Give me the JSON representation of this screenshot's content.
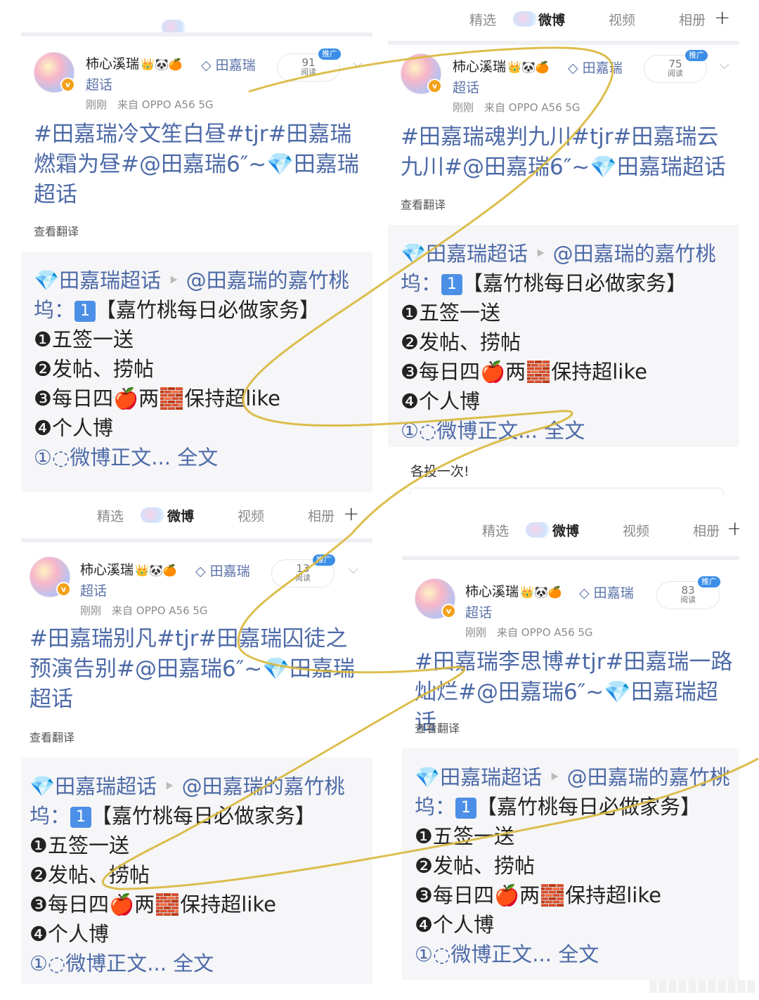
{
  "tabs": {
    "featured": "精选",
    "weibo": "微博",
    "video": "视频",
    "album": "相册"
  },
  "posts": [
    {
      "username": "柿心溪瑞",
      "badges": "👑🐼🍊",
      "topic": "田嘉瑞",
      "topic_suffix": "超话",
      "meta_time": "刚刚",
      "meta_source": "来自 OPPO A56 5G",
      "reads": "91",
      "reads_label": "阅读",
      "promo": "推广",
      "headline": "#田嘉瑞冷文笙白昼#tjr#田嘉瑞燃霜为昼#@田嘉瑞6″~💎田嘉瑞超话",
      "translate": "查看翻译",
      "quote_l1a": "💎田嘉瑞超话",
      "quote_l1b": "@田嘉瑞的嘉竹桃",
      "quote_l2a": "坞：",
      "quote_l2c": "【嘉竹桃每日必做家务】",
      "quote_l3": "❶五签一送",
      "quote_l4": "❷发帖、捞帖",
      "quote_l5": "❸每日四🍎两🧱保持超like",
      "quote_l6": "❹个人博",
      "quote_l7a": "①◌微博正文...",
      "quote_l7b": "全文",
      "comment_tip": "各投一次!"
    },
    {
      "username": "柿心溪瑞",
      "badges": "👑🐼🍊",
      "topic": "田嘉瑞",
      "topic_suffix": "超话",
      "meta_time": "刚刚",
      "meta_source": "来自 OPPO A56 5G",
      "reads": "75",
      "reads_label": "阅读",
      "promo": "推广",
      "headline": "#田嘉瑞魂判九川#tjr#田嘉瑞云九川#@田嘉瑞6″~💎田嘉瑞超话",
      "translate": "查看翻译",
      "quote_l1a": "💎田嘉瑞超话",
      "quote_l1b": "@田嘉瑞的嘉竹桃",
      "quote_l2a": "坞：",
      "quote_l2c": "【嘉竹桃每日必做家务】",
      "quote_l3": "❶五签一送",
      "quote_l4": "❷发帖、捞帖",
      "quote_l5": "❸每日四🍎两🧱保持超like",
      "quote_l6": "❹个人博",
      "quote_l7a": "①◌微博正文...",
      "quote_l7b": "全文",
      "comment_tip": "各投一次!"
    },
    {
      "username": "柿心溪瑞",
      "badges": "👑🐼🍊",
      "topic": "田嘉瑞",
      "topic_suffix": "超话",
      "meta_time": "刚刚",
      "meta_source": "来自 OPPO A56 5G",
      "reads": "13",
      "reads_label": "阅读",
      "promo": "推广",
      "headline": "#田嘉瑞别凡#tjr#田嘉瑞囚徒之预演告别#@田嘉瑞6″~💎田嘉瑞超话",
      "translate": "查看翻译",
      "quote_l1a": "💎田嘉瑞超话",
      "quote_l1b": "@田嘉瑞的嘉竹桃",
      "quote_l2a": "坞：",
      "quote_l2c": "【嘉竹桃每日必做家务】",
      "quote_l3": "❶五签一送",
      "quote_l4": "❷发帖、捞帖",
      "quote_l5": "❸每日四🍎两🧱保持超like",
      "quote_l6": "❹个人博",
      "quote_l7a": "①◌微博正文...",
      "quote_l7b": "全文"
    },
    {
      "username": "柿心溪瑞",
      "badges": "👑🐼🍊",
      "topic": "田嘉瑞",
      "topic_suffix": "超话",
      "meta_time": "刚刚",
      "meta_source": "来自 OPPO A56 5G",
      "reads": "83",
      "reads_label": "阅读",
      "promo": "推广",
      "headline": "#田嘉瑞李思博#tjr#田嘉瑞一路灿烂#@田嘉瑞6″~💎田嘉瑞超话",
      "translate": "查看翻译",
      "quote_l1a": "💎田嘉瑞超话",
      "quote_l1b": "@田嘉瑞的嘉竹桃",
      "quote_l2a": "坞：",
      "quote_l2c": "【嘉竹桃每日必做家务】",
      "quote_l3": "❶五签一送",
      "quote_l4": "❷发帖、捞帖",
      "quote_l5": "❸每日四🍎两🧱保持超like",
      "quote_l6": "❹个人博",
      "quote_l7a": "①◌微博正文...",
      "quote_l7b": "全文"
    }
  ],
  "num_badge": "1",
  "colors": {
    "link": "#4d6aa7",
    "scribble": "#d8b73a",
    "promo": "#3b8ee6"
  }
}
